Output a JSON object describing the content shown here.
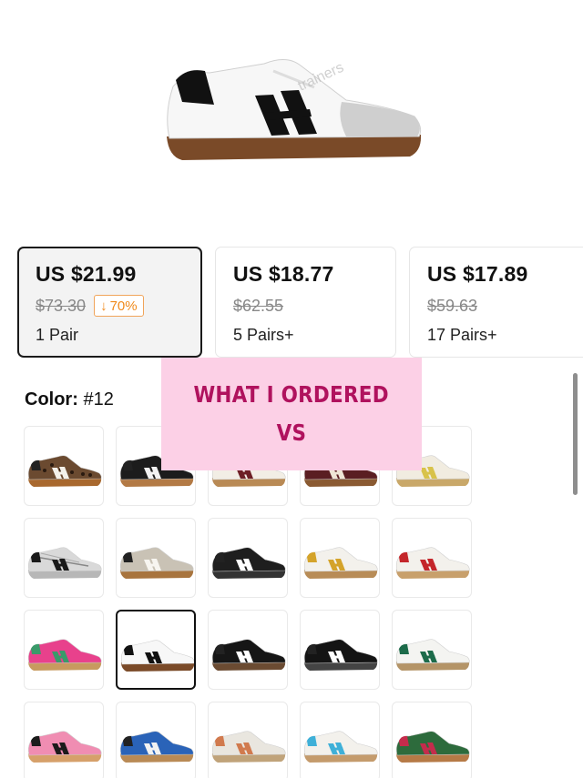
{
  "hero": {
    "image_alt": "White sneaker with black stripes and gum sole",
    "watermark": "trainers"
  },
  "tiers": [
    {
      "price": "US $21.99",
      "original": "$73.30",
      "discount": "70%",
      "discount_arrow": "↓",
      "qty": "1 Pair",
      "selected": true
    },
    {
      "price": "US $18.77",
      "original": "$62.55",
      "qty": "5 Pairs+",
      "selected": false
    },
    {
      "price": "US $17.89",
      "original": "$59.63",
      "qty": "17 Pairs+",
      "selected": false
    }
  ],
  "color": {
    "label": "Color:",
    "value": "#12"
  },
  "swatches": [
    {
      "upper": "#6b4a30",
      "stripe": "#f4f1ea",
      "sole": "#a8682e",
      "pattern": "leopard"
    },
    {
      "upper": "#1c1c1c",
      "stripe": "#f2f2f2",
      "sole": "#b37a45"
    },
    {
      "upper": "#f2eee5",
      "stripe": "#6d1f25",
      "sole": "#b98a55"
    },
    {
      "upper": "#5a1e22",
      "stripe": "#efe6d6",
      "sole": "#8a5a32"
    },
    {
      "upper": "#f1ece0",
      "stripe": "#d8c24a",
      "sole": "#c9a869"
    },
    {
      "upper": "#d9d9d9",
      "stripe": "#1a1a1a",
      "sole": "#b7b7b7",
      "pattern": "silver"
    },
    {
      "upper": "#c9c2b5",
      "stripe": "#f7f5f0",
      "sole": "#a8743e"
    },
    {
      "upper": "#1e1e1e",
      "stripe": "#ffffff",
      "sole": "#333333"
    },
    {
      "upper": "#f3f1ec",
      "stripe": "#d4a32a",
      "sole": "#b88c57"
    },
    {
      "upper": "#f3f1ec",
      "stripe": "#c4262b",
      "sole": "#c8a06c"
    },
    {
      "upper": "#e8418c",
      "stripe": "#3a9a6a",
      "sole": "#c79a5f"
    },
    {
      "upper": "#f7f7f7",
      "stripe": "#111111",
      "sole": "#7a4a28",
      "selected": true
    },
    {
      "upper": "#161616",
      "stripe": "#ffffff",
      "sole": "#6b4b32"
    },
    {
      "upper": "#141414",
      "stripe": "#ffffff",
      "sole": "#444444"
    },
    {
      "upper": "#f4f4f1",
      "stripe": "#1c6b4a",
      "sole": "#b49467"
    },
    {
      "upper": "#f08db2",
      "stripe": "#1b1b1b",
      "sole": "#d6a06a"
    },
    {
      "upper": "#2a63b8",
      "stripe": "#f2f2f2",
      "sole": "#b98a55"
    },
    {
      "upper": "#e9e6df",
      "stripe": "#d17a4e",
      "sole": "#c0a37a"
    },
    {
      "upper": "#f3f1ec",
      "stripe": "#3fb0d8",
      "sole": "#c49b6c"
    },
    {
      "upper": "#2d6b3c",
      "stripe": "#c42c4c",
      "sole": "#b67a46"
    }
  ],
  "overlay": {
    "line1": "WHAT I ORDERED",
    "line2": "VS"
  },
  "brand": {
    "accent": "#f08a1c",
    "overlay_bg": "#fcd0e6",
    "overlay_text": "#b0125e"
  }
}
